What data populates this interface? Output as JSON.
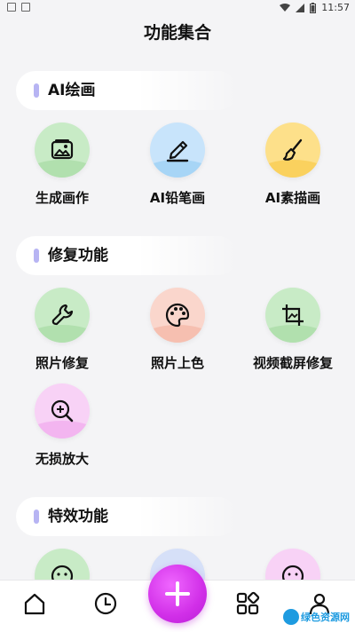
{
  "status": {
    "time": "11:57"
  },
  "header": {
    "title": "功能集合"
  },
  "sections": {
    "ai": {
      "title": "AI绘画",
      "items": [
        {
          "label": "生成画作",
          "color": "#b9e3b7",
          "icon": "image-icon"
        },
        {
          "label": "AI铅笔画",
          "color": "#b9dcf7",
          "icon": "pencil-icon"
        },
        {
          "label": "AI素描画",
          "color": "#fcd56a",
          "icon": "brush-icon"
        }
      ]
    },
    "repair": {
      "title": "修复功能",
      "items": [
        {
          "label": "照片修复",
          "color": "#b9e3b7",
          "icon": "wrench-icon"
        },
        {
          "label": "照片上色",
          "color": "#f7c9bd",
          "icon": "palette-icon"
        },
        {
          "label": "视频截屏修复",
          "color": "#b9e3b7",
          "icon": "crop-icon"
        },
        {
          "label": "无损放大",
          "color": "#f6c3f4",
          "icon": "zoom-in-icon"
        }
      ]
    },
    "effects": {
      "title": "特效功能",
      "items": [
        {
          "label": "",
          "color": "#b9e3b7",
          "icon": "face-icon"
        },
        {
          "label": "",
          "color": "#c8d6f6",
          "icon": "effect-icon"
        },
        {
          "label": "",
          "color": "#f6c3f4",
          "icon": "sparkle-face-icon"
        }
      ]
    }
  },
  "bottom_nav": {
    "items": [
      "home-icon",
      "history-icon",
      "add-icon",
      "grid-icon",
      "profile-icon"
    ],
    "fab_color": "#d12fe8"
  },
  "watermark": {
    "text": "绿色资源网"
  }
}
